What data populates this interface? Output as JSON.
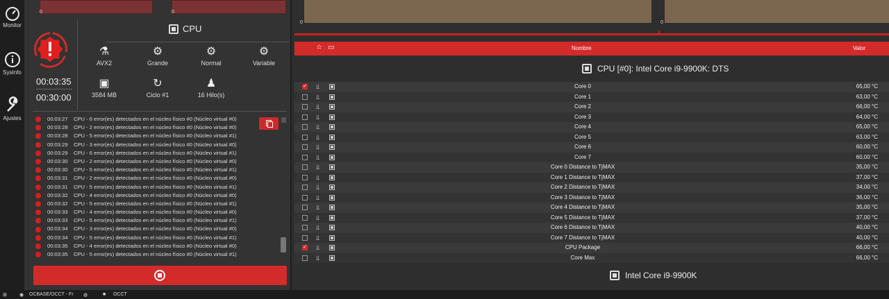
{
  "nav": {
    "items": [
      {
        "label": "Monitor",
        "icon": "gauge-icon"
      },
      {
        "label": "SysInfo",
        "icon": "info-icon"
      },
      {
        "label": "Ajustes",
        "icon": "wrench-icon"
      }
    ]
  },
  "left": {
    "graph_zero": "0",
    "timers": {
      "elapsed": "00:03:35",
      "total": "00:30:00"
    },
    "test_title": "CPU",
    "options": [
      {
        "label": "AVX2",
        "icon": "flask-icon"
      },
      {
        "label": "Grande",
        "icon": "gears-icon"
      },
      {
        "label": "Normal",
        "icon": "gears-icon"
      },
      {
        "label": "Variable",
        "icon": "gears-icon"
      },
      {
        "label": "3584 MB",
        "icon": "memory-icon"
      },
      {
        "label": "Ciclo #1",
        "icon": "refresh-icon"
      },
      {
        "label": "16 Hilo(s)",
        "icon": "worker-icon"
      }
    ],
    "log": [
      {
        "time": "00:03:27",
        "msg": "CPU - 6 error(es) detectados en el núcleo físico #0 (Núcleo virtual #0)"
      },
      {
        "time": "00:03:28",
        "msg": "CPU - 2 error(es) detectados en el núcleo físico #0 (Núcleo virtual #0)"
      },
      {
        "time": "00:03:28",
        "msg": "CPU - 5 error(es) detectados en el núcleo físico #0 (Núcleo virtual #1)"
      },
      {
        "time": "00:03:29",
        "msg": "CPU - 3 error(es) detectados en el núcleo físico #0 (Núcleo virtual #0)"
      },
      {
        "time": "00:03:29",
        "msg": "CPU - 6 error(es) detectados en el núcleo físico #0 (Núcleo virtual #1)"
      },
      {
        "time": "00:03:30",
        "msg": "CPU - 2 error(es) detectados en el núcleo físico #0 (Núcleo virtual #0)"
      },
      {
        "time": "00:03:30",
        "msg": "CPU - 5 error(es) detectados en el núcleo físico #0 (Núcleo virtual #1)"
      },
      {
        "time": "00:03:31",
        "msg": "CPU - 2 error(es) detectados en el núcleo físico #0 (Núcleo virtual #0)"
      },
      {
        "time": "00:03:31",
        "msg": "CPU - 5 error(es) detectados en el núcleo físico #0 (Núcleo virtual #1)"
      },
      {
        "time": "00:03:32",
        "msg": "CPU - 4 error(es) detectados en el núcleo físico #0 (Núcleo virtual #0)"
      },
      {
        "time": "00:03:32",
        "msg": "CPU - 5 error(es) detectados en el núcleo físico #0 (Núcleo virtual #1)"
      },
      {
        "time": "00:03:33",
        "msg": "CPU - 4 error(es) detectados en el núcleo físico #0 (Núcleo virtual #0)"
      },
      {
        "time": "00:03:33",
        "msg": "CPU - 5 error(es) detectados en el núcleo físico #0 (Núcleo virtual #1)"
      },
      {
        "time": "00:03:34",
        "msg": "CPU - 3 error(es) detectados en el núcleo físico #0 (Núcleo virtual #0)"
      },
      {
        "time": "00:03:34",
        "msg": "CPU - 5 error(es) detectados en el núcleo físico #0 (Núcleo virtual #1)"
      },
      {
        "time": "00:03:35",
        "msg": "CPU - 4 error(es) detectados en el núcleo físico #0 (Núcleo virtual #0)"
      },
      {
        "time": "00:03:35",
        "msg": "CPU - 5 error(es) detectados en el núcleo físico #0 (Núcleo virtual #1)"
      }
    ]
  },
  "right": {
    "graph_zero": "0",
    "columns": {
      "name": "Nombre",
      "value": "Valor"
    },
    "section1": "CPU [#0]: Intel Core i9-9900K: DTS",
    "section2": "Intel Core i9-9900K",
    "rows": [
      {
        "name": "Core 0",
        "value": "65,00 °C",
        "checked": true
      },
      {
        "name": "Core 1",
        "value": "63,00 °C",
        "checked": false
      },
      {
        "name": "Core 2",
        "value": "66,00 °C",
        "checked": false
      },
      {
        "name": "Core 3",
        "value": "64,00 °C",
        "checked": false
      },
      {
        "name": "Core 4",
        "value": "65,00 °C",
        "checked": false
      },
      {
        "name": "Core 5",
        "value": "63,00 °C",
        "checked": false
      },
      {
        "name": "Core 6",
        "value": "60,00 °C",
        "checked": false
      },
      {
        "name": "Core 7",
        "value": "60,00 °C",
        "checked": false
      },
      {
        "name": "Core 0 Distance to TjMAX",
        "value": "35,00 °C",
        "checked": false
      },
      {
        "name": "Core 1 Distance to TjMAX",
        "value": "37,00 °C",
        "checked": false
      },
      {
        "name": "Core 2 Distance to TjMAX",
        "value": "34,00 °C",
        "checked": false
      },
      {
        "name": "Core 3 Distance to TjMAX",
        "value": "36,00 °C",
        "checked": false
      },
      {
        "name": "Core 4 Distance to TjMAX",
        "value": "35,00 °C",
        "checked": false
      },
      {
        "name": "Core 5 Distance to TjMAX",
        "value": "37,00 °C",
        "checked": false
      },
      {
        "name": "Core 6 Distance to TjMAX",
        "value": "40,00 °C",
        "checked": false
      },
      {
        "name": "Core 7 Distance to TjMAX",
        "value": "40,00 °C",
        "checked": false
      },
      {
        "name": "CPU Package",
        "value": "66,00 °C",
        "checked": true
      },
      {
        "name": "Core Max",
        "value": "66,00 °C",
        "checked": false
      }
    ]
  },
  "taskbar": {
    "items": [
      {
        "label": "OCBASE/OCCT - Fr",
        "icon": "chrome-icon"
      },
      {
        "label": "OCCT",
        "icon": "occt-icon"
      }
    ]
  },
  "colors": {
    "accent": "#d32a2a",
    "graph_left": "#7a3333",
    "graph_right": "#7b6650"
  }
}
